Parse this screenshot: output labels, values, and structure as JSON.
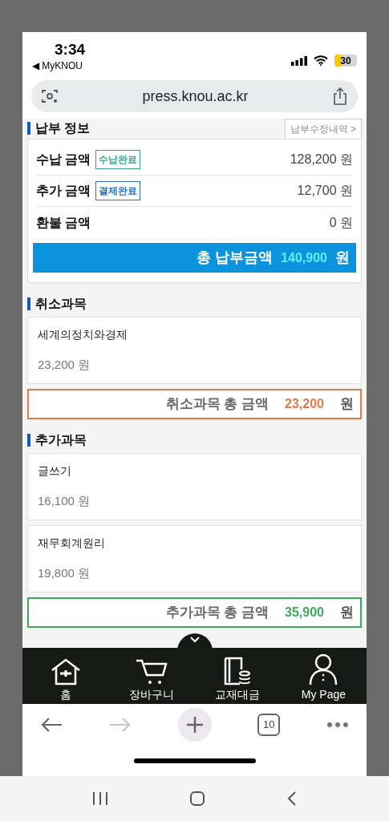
{
  "status_bar": {
    "time": "3:34",
    "back_app": "◀ MyKNOU",
    "battery": "30"
  },
  "browser": {
    "url": "press.knou.ac.kr",
    "tab_count": "10",
    "forward_disabled": true
  },
  "payment_info": {
    "title": "납부 정보",
    "history_link": "납부수정내역 >",
    "rows": [
      {
        "label": "수납 금액",
        "badge": "수납완료",
        "color": "#3aa58a",
        "amount": "128,200 원"
      },
      {
        "label": "추가 금액",
        "badge": "결제완료",
        "color": "#2f6fc6",
        "amount": "12,700 원"
      },
      {
        "label": "환불 금액",
        "amount": "0 원"
      }
    ],
    "total": {
      "label": "총 납부금액",
      "amount": "140,900",
      "unit": "원"
    }
  },
  "sections": [
    {
      "title": "취소과목",
      "color": "#e07b4a",
      "courses": [
        {
          "name": "세계의정치와경제",
          "price": "23,200 원"
        }
      ],
      "total": {
        "label": "취소과목 총 금액",
        "amount": "23,200",
        "unit": "원"
      }
    },
    {
      "title": "추가과목",
      "color": "#3daa5a",
      "courses": [
        {
          "name": "글쓰기",
          "price": "16,100 원"
        },
        {
          "name": "재무회계원리",
          "price": "19,800 원"
        }
      ],
      "total": {
        "label": "추가과목 총 금액",
        "amount": "35,900",
        "unit": "원"
      }
    }
  ],
  "bottom_nav": [
    {
      "label": "홈"
    },
    {
      "label": "장바구니"
    },
    {
      "label": "교재대금"
    },
    {
      "label": "My Page"
    }
  ]
}
